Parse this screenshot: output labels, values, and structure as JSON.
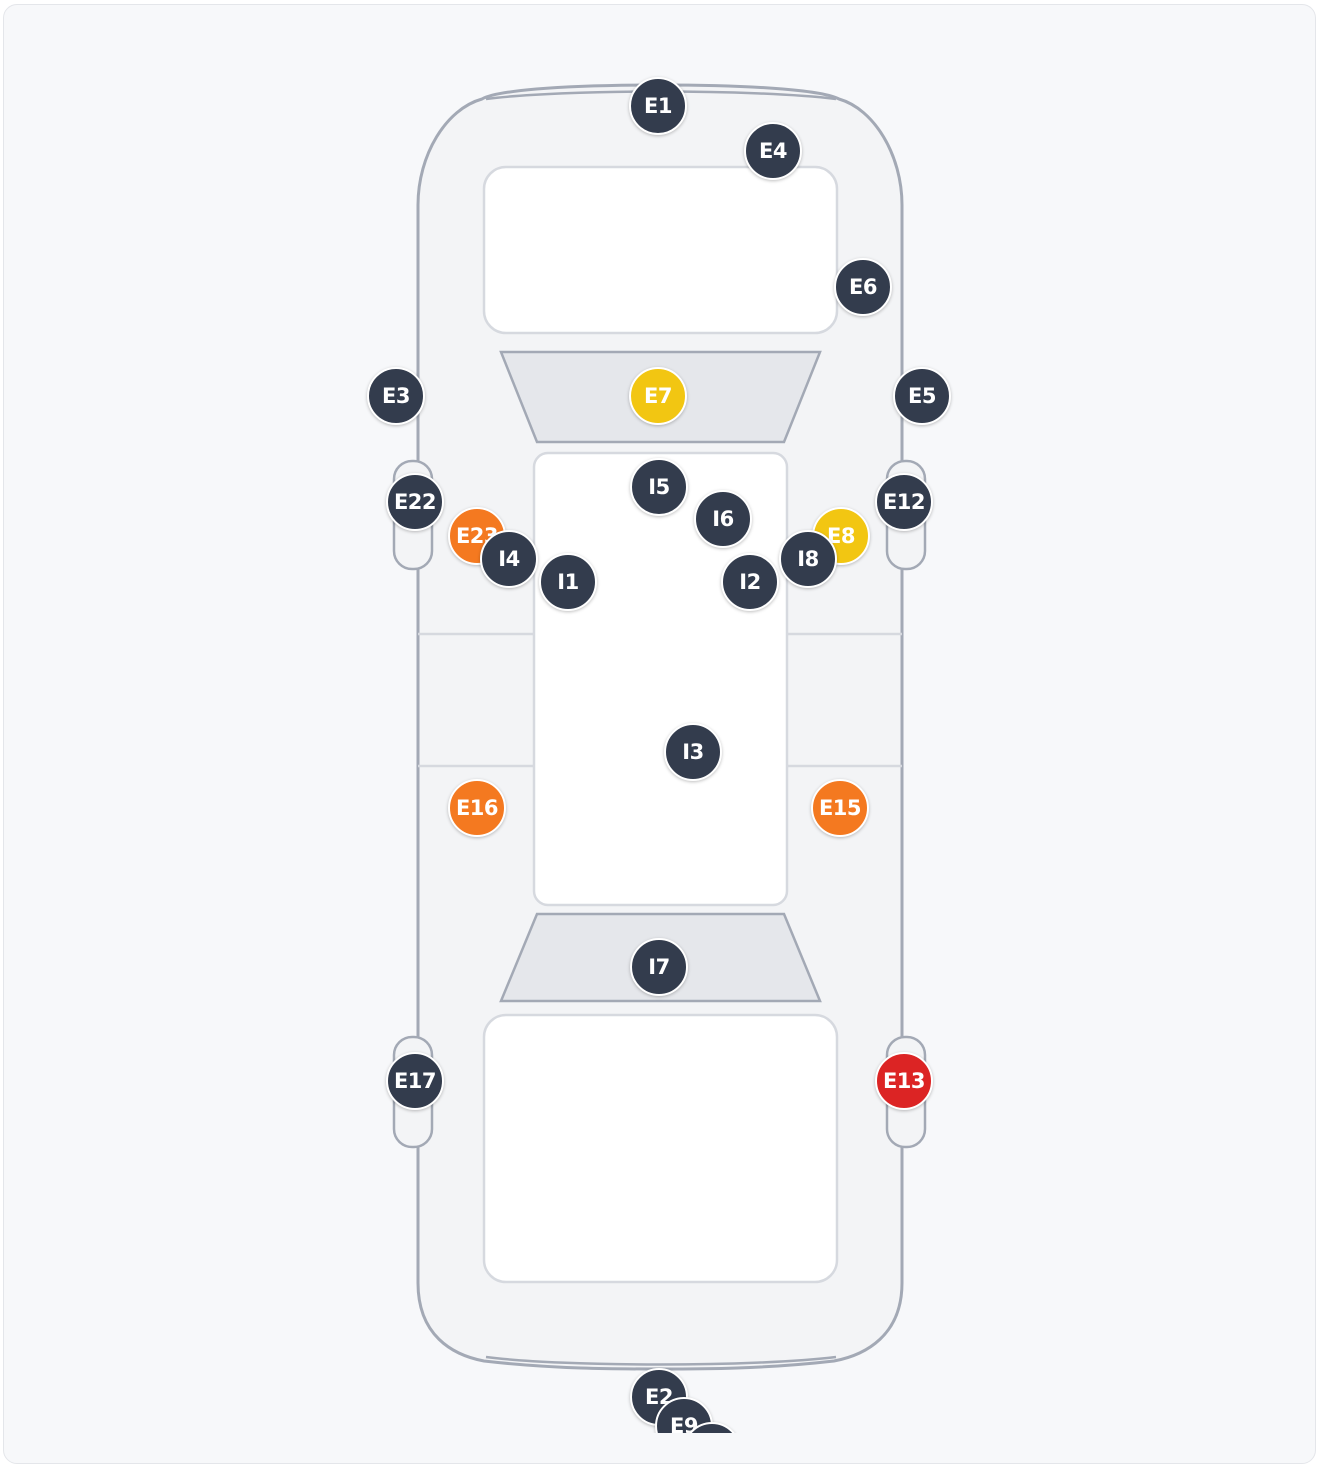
{
  "colors": {
    "default": "#333c4d",
    "yellow": "#f2c612",
    "orange": "#f47920",
    "red": "#dc2424",
    "body_fill": "#f3f4f6",
    "body_stroke": "#a3a9b5",
    "glass_fill": "#e5e7eb",
    "panel_fill": "#ffffff",
    "panel_stroke": "#d6d9df"
  },
  "markers": [
    {
      "id": "E1",
      "label": "E1",
      "color": "default"
    },
    {
      "id": "E4",
      "label": "E4",
      "color": "default"
    },
    {
      "id": "E6",
      "label": "E6",
      "color": "default"
    },
    {
      "id": "E3",
      "label": "E3",
      "color": "default"
    },
    {
      "id": "E7",
      "label": "E7",
      "color": "yellow"
    },
    {
      "id": "E5",
      "label": "E5",
      "color": "default"
    },
    {
      "id": "E23",
      "label": "E23",
      "color": "orange"
    },
    {
      "id": "E8",
      "label": "E8",
      "color": "yellow"
    },
    {
      "id": "E22",
      "label": "E22",
      "color": "default"
    },
    {
      "id": "E12",
      "label": "E12",
      "color": "default"
    },
    {
      "id": "I5",
      "label": "I5",
      "color": "default"
    },
    {
      "id": "I6",
      "label": "I6",
      "color": "default"
    },
    {
      "id": "I4",
      "label": "I4",
      "color": "default"
    },
    {
      "id": "I1",
      "label": "I1",
      "color": "default"
    },
    {
      "id": "I2",
      "label": "I2",
      "color": "default"
    },
    {
      "id": "I8",
      "label": "I8",
      "color": "default"
    },
    {
      "id": "I3",
      "label": "I3",
      "color": "default"
    },
    {
      "id": "E16",
      "label": "E16",
      "color": "orange"
    },
    {
      "id": "E15",
      "label": "E15",
      "color": "orange"
    },
    {
      "id": "I7",
      "label": "I7",
      "color": "default"
    },
    {
      "id": "E17",
      "label": "E17",
      "color": "default"
    },
    {
      "id": "E13",
      "label": "E13",
      "color": "red"
    },
    {
      "id": "E2",
      "label": "E2",
      "color": "default"
    },
    {
      "id": "E9",
      "label": "E9",
      "color": "default"
    },
    {
      "id": "E10",
      "label": "",
      "color": "default"
    }
  ]
}
